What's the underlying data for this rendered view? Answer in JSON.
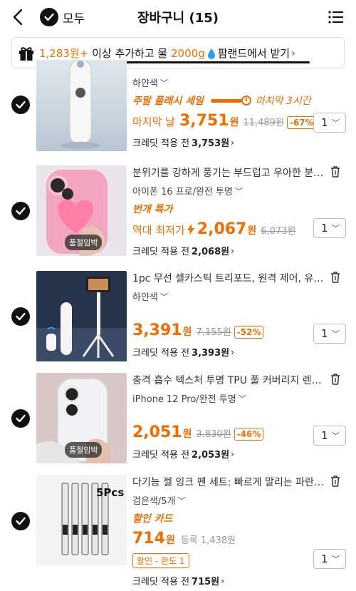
{
  "header": {
    "select_all_label": "모두",
    "title": "장바구니 (15)"
  },
  "banner": {
    "amount": "1,283원+",
    "text1": "이상 추가하고 물",
    "water": "2000g",
    "text2": "팜랜드에서 받기"
  },
  "items": [
    {
      "option": "하얀색",
      "flash_label": "주말 플래시 세일",
      "flash_remain": "마지막 3시간",
      "price_prefix": "마지막 날",
      "price": "3,751",
      "won": "원",
      "orig": "11,489원",
      "disc": "-67%",
      "credit_label": "크레딧 적용 전",
      "credit_price": "3,753원",
      "qty": "1"
    },
    {
      "name": "분위기를 강하게 풍기는 부드럽고 우아한 분…",
      "option": "아이폰 16 프로/완전 투명",
      "promo": "번개 특가",
      "price_prefix": "역대 최저가",
      "price": "2,067",
      "won": "원",
      "orig": "6,073원",
      "credit_label": "크레딧 적용 전",
      "credit_price": "2,068원",
      "qty": "1",
      "soldout": "품절임박"
    },
    {
      "name": "1pc 무선 셀카스틱 트리포드, 원격 제어, 유…",
      "option": "하얀색",
      "price": "3,391",
      "won": "원",
      "orig": "7,155원",
      "disc": "-52%",
      "credit_label": "크레딧 적용 전",
      "credit_price": "3,393원",
      "qty": "1"
    },
    {
      "name": "충격 흡수 텍스처 투명 TPU 풀 커버리지 렌…",
      "option": "iPhone 12 Pro/완전 투명",
      "price": "2,051",
      "won": "원",
      "orig": "3,830원",
      "disc": "-46%",
      "credit_label": "크레딧 적용 전",
      "credit_price": "2,053원",
      "qty": "1",
      "soldout": "품절임박"
    },
    {
      "name": "다기능 젤 잉크 펜 세트: 빠르게 말리는 파란…",
      "option": "검은색/5개",
      "promo": "할인 카드",
      "price": "714",
      "won": "원",
      "reg": "등록 1,438원",
      "coupon": "할인 - 한도 1",
      "credit_label": "크레딧 적용 전",
      "credit_price": "715원",
      "qty": "1",
      "pcs": "5Pcs"
    }
  ],
  "colors": {
    "accent": "#ef6c00",
    "check": "#111111"
  }
}
